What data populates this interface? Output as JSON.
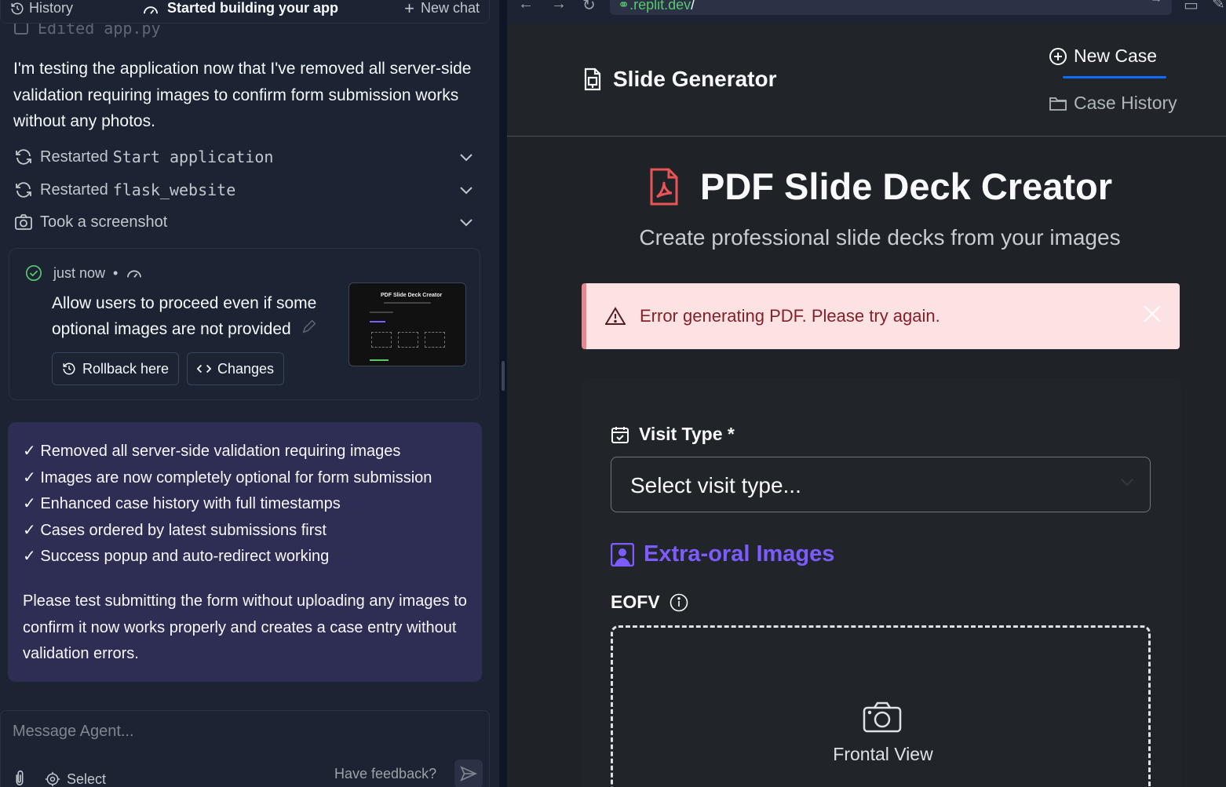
{
  "chat": {
    "topbar": {
      "history": "History",
      "title": "Started building your app",
      "new_chat": "New chat"
    },
    "edited_file": "Edited app.py",
    "message": "I'm testing the application now that I've removed all server-side validation requiring images to confirm form submission works without any photos.",
    "actions": [
      {
        "prefix": "Restarted",
        "code": "Start application"
      },
      {
        "prefix": "Restarted",
        "code": "flask_website"
      },
      {
        "prefix": "Took a screenshot",
        "code": ""
      }
    ],
    "checkpoint": {
      "time": "just now",
      "separator": "•",
      "text": "Allow users to proceed even if some optional images are not provided",
      "rollback_label": "Rollback here",
      "changes_label": "Changes",
      "thumbnail_title": "PDF Slide Deck Creator"
    },
    "summary": {
      "items": [
        "✓ Removed all server-side validation requiring images",
        "✓ Images are now completely optional for form submission",
        "✓ Enhanced case history with full timestamps",
        "✓ Cases ordered by latest submissions first",
        "✓ Success popup and auto-redirect working"
      ],
      "closing": "Please test submitting the form without uploading any images to confirm it now works properly and creates a case entry without validation errors."
    },
    "composer": {
      "placeholder": "Message Agent...",
      "select_label": "Select",
      "feedback": "Have feedback?"
    }
  },
  "browser": {
    "url_prefix": ".replit.dev",
    "url_suffix": "/"
  },
  "app": {
    "brand": "Slide Generator",
    "nav": {
      "new_case": "New Case",
      "case_history": "Case History"
    },
    "hero_title": "PDF Slide Deck Creator",
    "hero_subtitle": "Create professional slide decks from your images",
    "alert": "Error generating PDF. Please try again.",
    "visit_type_label": "Visit Type *",
    "visit_type_value": "Select visit type...",
    "section_title": "Extra-oral Images",
    "field_label": "EOFV",
    "dropzone_text": "Frontal View"
  },
  "colors": {
    "accent_blue": "#0d6efd",
    "section_purple": "#7c5cff",
    "alert_bg": "#fde2e4",
    "alert_text": "#842029",
    "chat_summary_bg": "#2e2d54"
  }
}
